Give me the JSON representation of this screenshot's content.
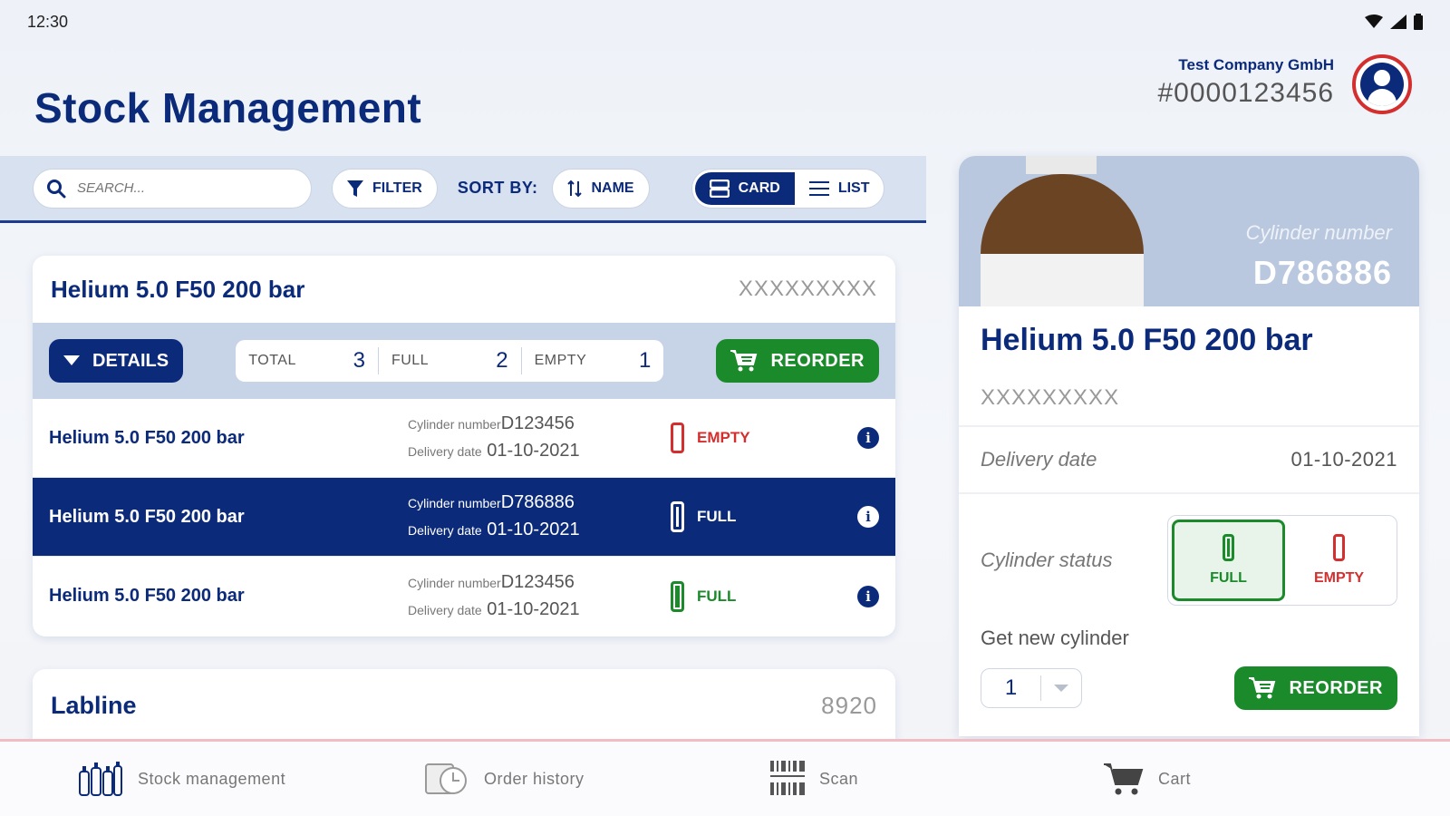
{
  "status_bar": {
    "time": "12:30"
  },
  "header": {
    "title": "Stock Management",
    "company_name": "Test Company GmbH",
    "company_id": "#0000123456"
  },
  "toolbar": {
    "search_placeholder": "SEARCH...",
    "filter_label": "FILTER",
    "sort_label": "SORT BY:",
    "sort_value": "NAME",
    "view_card_label": "CARD",
    "view_list_label": "LIST",
    "active_view": "CARD"
  },
  "product_card": {
    "title": "Helium 5.0 F50 200 bar",
    "code": "XXXXXXXXX",
    "details_label": "DETAILS",
    "counts": [
      {
        "label": "TOTAL",
        "value": "3"
      },
      {
        "label": "FULL",
        "value": "2"
      },
      {
        "label": "EMPTY",
        "value": "1"
      }
    ],
    "reorder_label": "REORDER",
    "rows": [
      {
        "name": "Helium 5.0 F50 200 bar",
        "cylinder_key": "Cylinder number",
        "cylinder_number": "D123456",
        "date_key": "Delivery date",
        "delivery_date": "01-10-2021",
        "status": "EMPTY",
        "selected": false
      },
      {
        "name": "Helium 5.0 F50 200 bar",
        "cylinder_key": "Cylinder number",
        "cylinder_number": "D786886",
        "date_key": "Delivery date",
        "delivery_date": "01-10-2021",
        "status": "FULL",
        "selected": true
      },
      {
        "name": "Helium 5.0 F50 200 bar",
        "cylinder_key": "Cylinder number",
        "cylinder_number": "D123456",
        "date_key": "Delivery date",
        "delivery_date": "01-10-2021",
        "status": "FULL",
        "selected": false
      }
    ]
  },
  "product_card_2": {
    "title": "Labline",
    "code": "8920"
  },
  "detail_panel": {
    "cylinder_label": "Cylinder number",
    "cylinder_number": "D786886",
    "title": "Helium 5.0 F50 200 bar",
    "code": "XXXXXXXXX",
    "delivery_date_label": "Delivery date",
    "delivery_date": "01-10-2021",
    "cylinder_status_label": "Cylinder status",
    "status_full_label": "FULL",
    "status_empty_label": "EMPTY",
    "active_status": "FULL",
    "get_new_label": "Get new cylinder",
    "quantity": "1",
    "reorder_label": "REORDER"
  },
  "bottom_nav": {
    "items": [
      {
        "label": "Stock management",
        "icon": "cylinders-icon"
      },
      {
        "label": "Order history",
        "icon": "order-history-icon"
      },
      {
        "label": "Scan",
        "icon": "barcode-icon"
      },
      {
        "label": "Cart",
        "icon": "cart-icon"
      }
    ]
  },
  "colors": {
    "brand_blue": "#0b2a7a",
    "reorder_green": "#1a8a2a",
    "empty_red": "#d32f2f",
    "full_green": "#1a8a2a",
    "toolbar_bg": "#d8e1ef"
  }
}
